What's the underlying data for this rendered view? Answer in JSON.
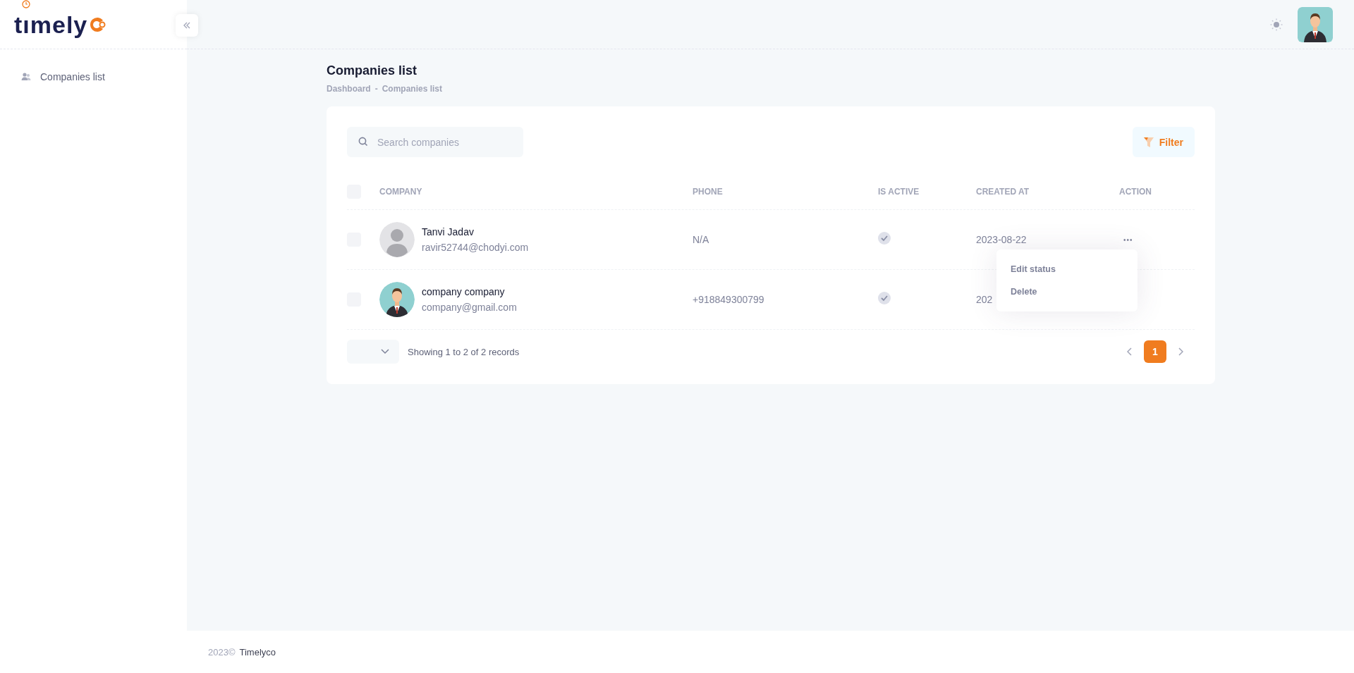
{
  "logo": {
    "text": "tımely"
  },
  "sidebar": {
    "items": [
      {
        "label": "Companies list",
        "selected": false
      }
    ]
  },
  "page": {
    "title": "Companies list",
    "breadcrumb": [
      "Dashboard",
      "-",
      "Companies list"
    ]
  },
  "search": {
    "placeholder": "Search companies"
  },
  "filter_button": {
    "label": "Filter"
  },
  "table": {
    "select_all_checked": false,
    "columns": [
      "COMPANY",
      "PHONE",
      "IS ACTIVE",
      "CREATED AT",
      "ACTION"
    ],
    "rows": [
      {
        "checked": false,
        "avatar": {
          "kind": "generic"
        },
        "name": "Tanvi Jadav",
        "email": "ravir52744@chodyi.com",
        "phone": "N/A",
        "is_active": true,
        "created_at": "2023-08-22",
        "action": "•••"
      },
      {
        "checked": false,
        "avatar": {
          "kind": "person"
        },
        "name": "company company",
        "email": "company@gmail.com",
        "phone": "+918849300799",
        "is_active": true,
        "created_at": "202"
      }
    ]
  },
  "action_menu": {
    "items": [
      "Edit status",
      "Delete"
    ]
  },
  "pagination": {
    "summary": "Showing 1 to 2 of 2 records",
    "pages": [
      {
        "label": "1",
        "selected": true
      }
    ]
  },
  "footer": {
    "year": "2023©",
    "brand": "Timelyco"
  }
}
